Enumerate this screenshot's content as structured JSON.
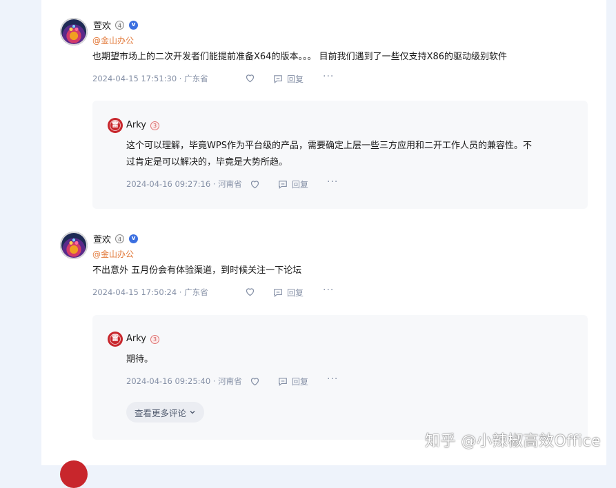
{
  "comments": [
    {
      "author": "萱欢",
      "level": "4",
      "verified_mark": "v",
      "org": "@金山办公",
      "text": "也期望市场上的二次开发者们能提前准备X64的版本。。。 目前我们遇到了一些仅支持X86的驱动级别软件",
      "time": "2024-04-15 17:51:30 · 广东省",
      "reply_label": "回复",
      "more": "···",
      "reply": {
        "author": "Arky",
        "avatar_text": "雷",
        "level": "3",
        "text_line1": "这个可以理解，毕竟WPS作为平台级的产品，需要确定上层一些三方应用和二开工作人员的兼容性。不",
        "text_line2": "过肯定是可以解决的，毕竟是大势所趋。",
        "time": "2024-04-16 09:27:16 · 河南省",
        "reply_label": "回复",
        "more": "···"
      }
    },
    {
      "author": "萱欢",
      "level": "4",
      "verified_mark": "v",
      "org": "@金山办公",
      "text": "不出意外 五月份会有体验渠道，到时候关注一下论坛",
      "time": "2024-04-15 17:50:24 · 广东省",
      "reply_label": "回复",
      "more": "···",
      "reply": {
        "author": "Arky",
        "avatar_text": "雷",
        "level": "3",
        "text_line1": "期待。",
        "time": "2024-04-16 09:25:40 · 河南省",
        "reply_label": "回复",
        "more": "···"
      },
      "more_comments": "查看更多评论"
    }
  ],
  "watermark": "知乎 @小辣椒高效Office",
  "colors": {
    "org": "#e2793a",
    "meta": "#8590a6",
    "verify": "#3b6fe0",
    "reply_bg": "#f7f8fa",
    "page_bg": "#eef3fb"
  },
  "icons": [
    "heart-icon",
    "comment-icon",
    "more-icon",
    "chevron-down-icon",
    "verified-icon"
  ]
}
